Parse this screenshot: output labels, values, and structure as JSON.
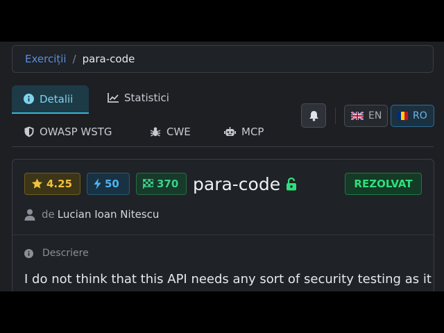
{
  "breadcrumb": {
    "parent": "Exerciții",
    "separator": "/",
    "current": "para-code"
  },
  "tabs": [
    {
      "label": "Detalii",
      "icon": "info-circle-icon",
      "active": true
    },
    {
      "label": "Statistici",
      "icon": "chart-line-icon"
    },
    {
      "label": "OWASP WSTG",
      "icon": "shield-icon"
    },
    {
      "label": "CWE",
      "icon": "bug-icon"
    },
    {
      "label": "MCP",
      "icon": "robot-icon"
    }
  ],
  "toolbar": {
    "bell_icon": "bell-icon",
    "languages": [
      {
        "code": "EN",
        "flag": "uk-flag-icon",
        "active": false
      },
      {
        "code": "RO",
        "flag": "ro-flag-icon",
        "active": true
      }
    ]
  },
  "challenge": {
    "rating": "4.25",
    "points": "50",
    "solves": "370",
    "title": "para-code",
    "lock_icon": "unlock-icon",
    "status": "REZOLVAT",
    "author_prefix": "de",
    "author": "Lucian Ioan Nitescu",
    "description_label": "Descriere",
    "description": "I do not think that this API needs any sort of security testing as it"
  },
  "colors": {
    "accent": "#38b6d8",
    "link": "#5b8ee0",
    "success": "#2ee07a",
    "rating": "#f0c23a",
    "points": "#4fb3f0",
    "background": "#1d1f23"
  }
}
